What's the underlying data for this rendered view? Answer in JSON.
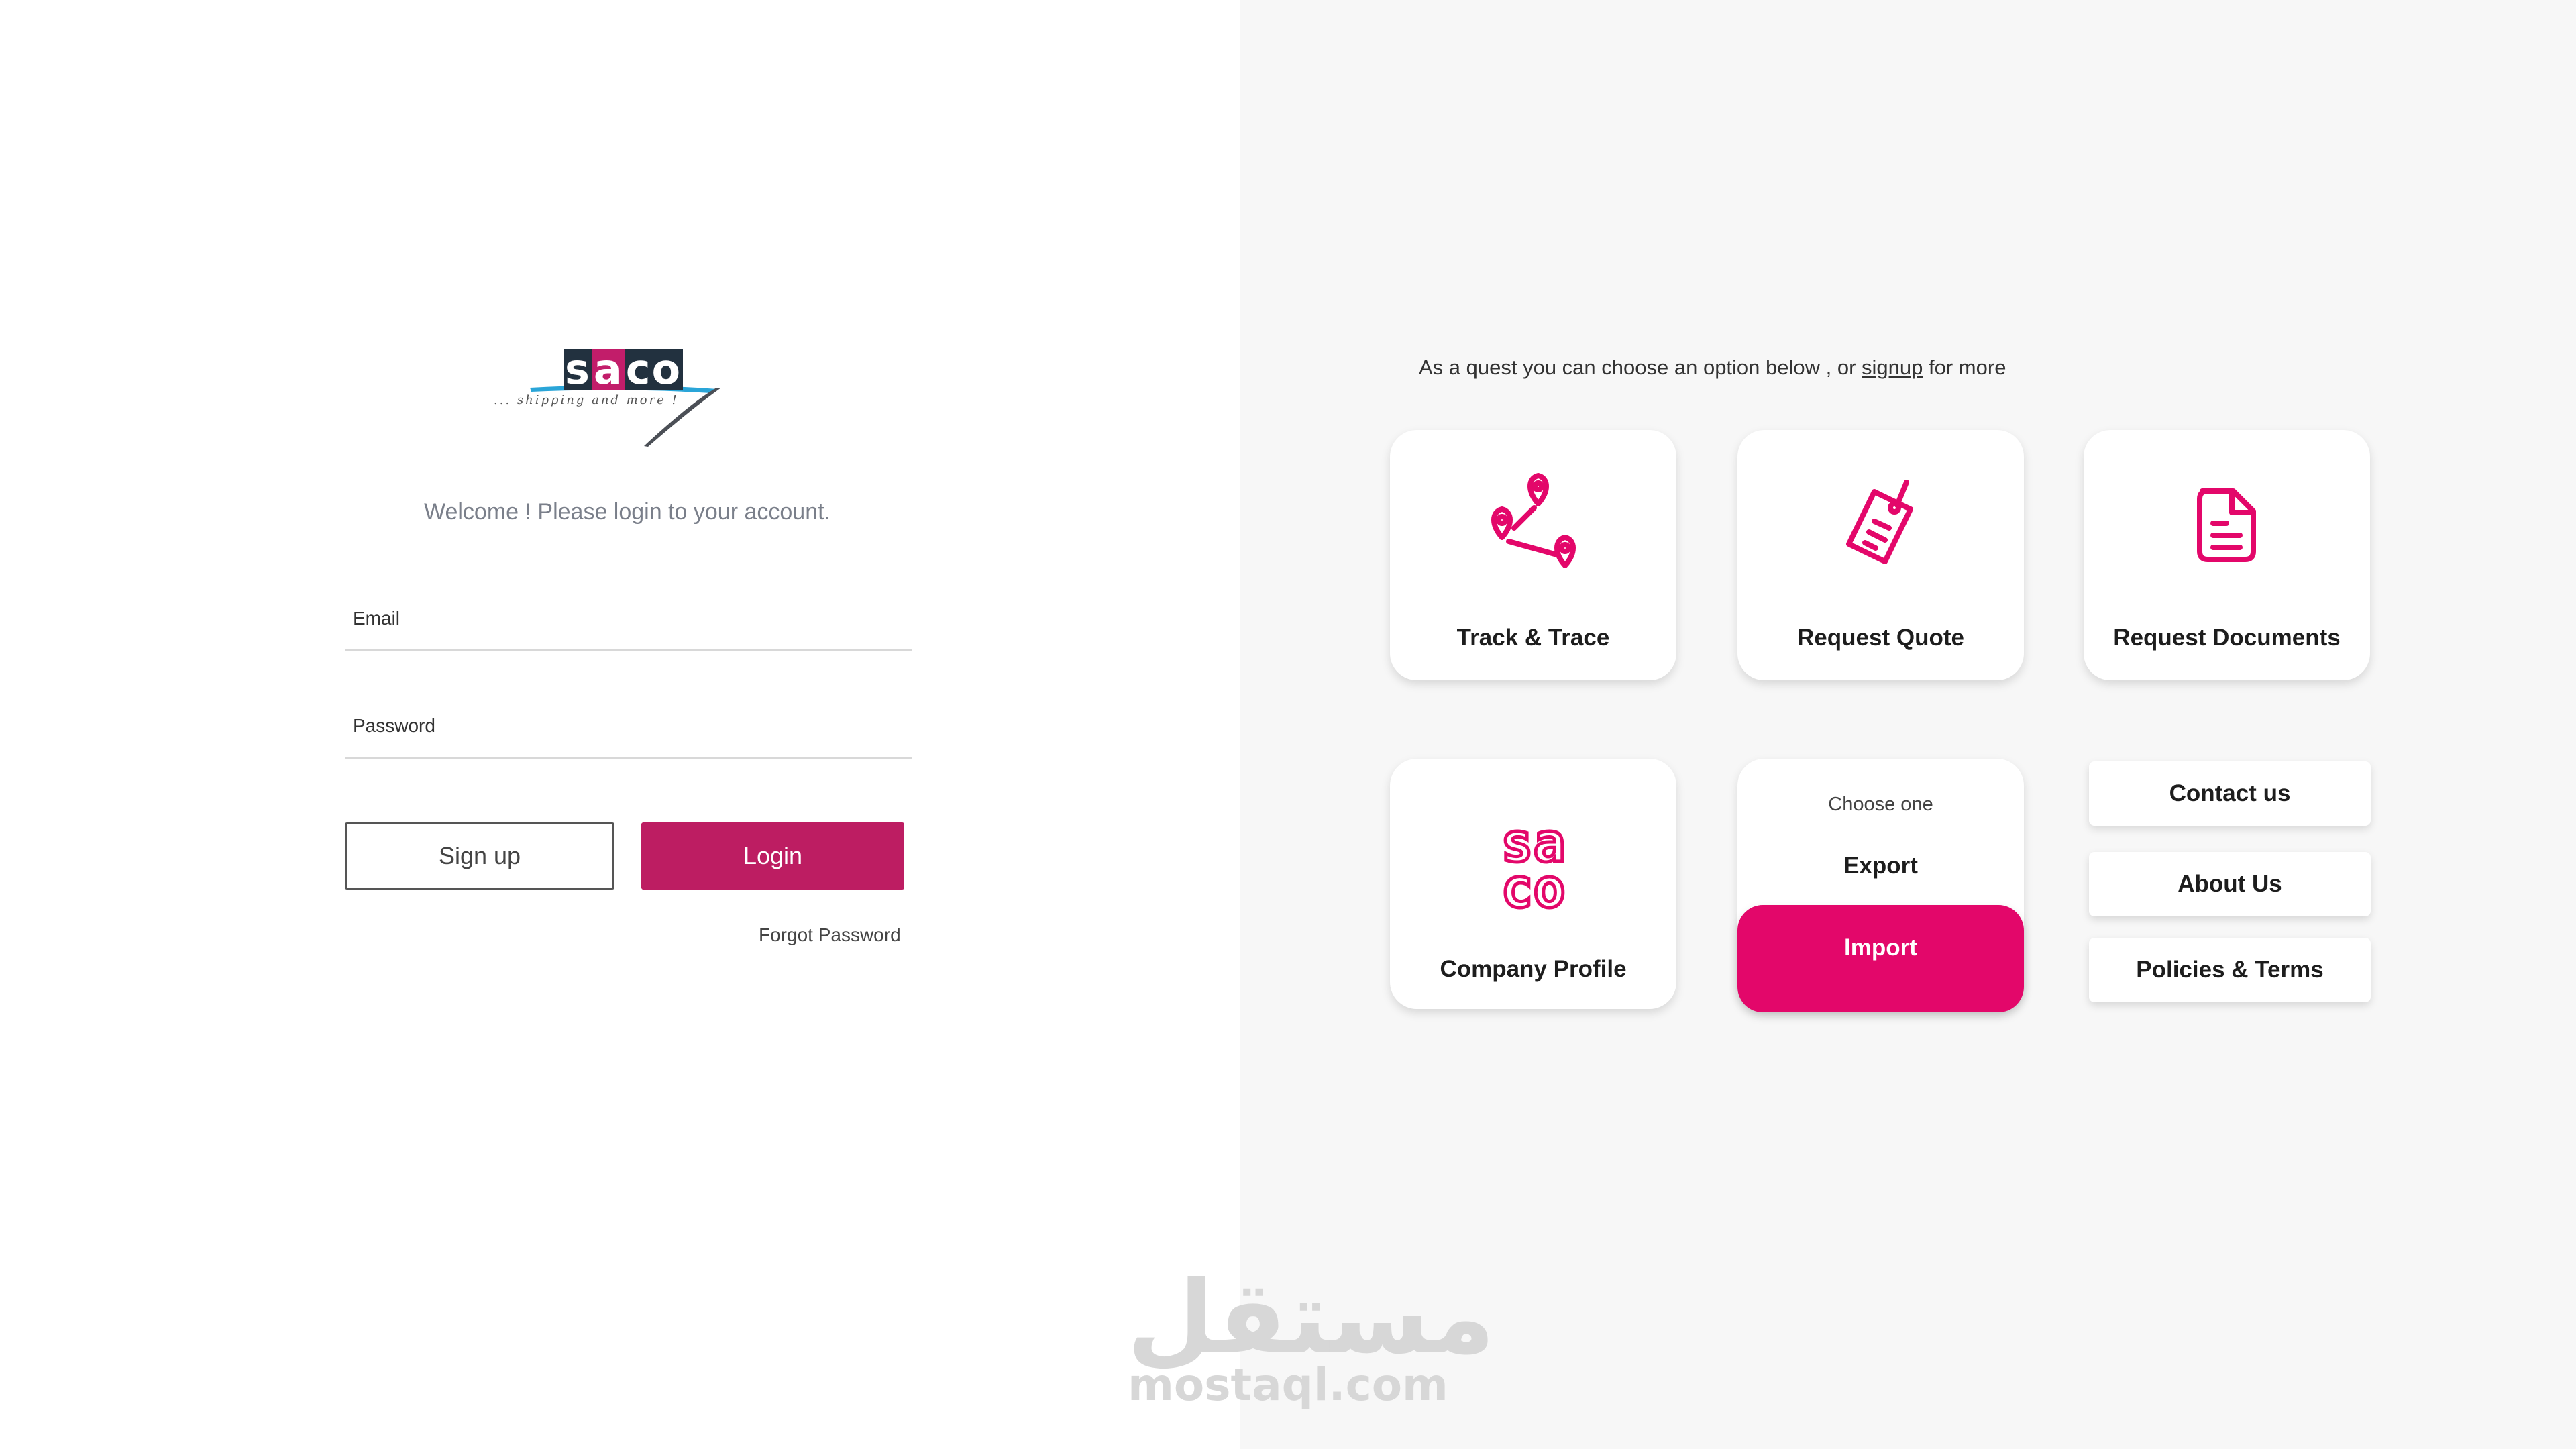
{
  "logo": {
    "word_parts": [
      "s",
      "a",
      "co"
    ],
    "tagline": "... shipping and more !"
  },
  "login": {
    "welcome": "Welcome ! Please login to your account.",
    "email_label": "Email",
    "password_label": "Password",
    "signup_label": "Sign up",
    "login_label": "Login",
    "forgot_label": "Forgot Password"
  },
  "guest": {
    "prefix": "As a quest you can choose an option below , or ",
    "link": "signup",
    "suffix": " for more"
  },
  "cards": {
    "track": "Track & Trace",
    "quote": "Request Quote",
    "documents": "Request Documents",
    "company": "Company Profile",
    "company_icon_text": [
      "sa",
      "co"
    ],
    "choose": "Choose one",
    "export": "Export",
    "import": "Import"
  },
  "links": {
    "contact": "Contact us",
    "about": "About Us",
    "policies": "Policies & Terms"
  },
  "watermark": {
    "arabic": "مستقل",
    "latin": "mostaql.com"
  },
  "colors": {
    "accent": "#e3076a",
    "login_button": "#bd1d62",
    "logo_dark": "#22313f"
  }
}
